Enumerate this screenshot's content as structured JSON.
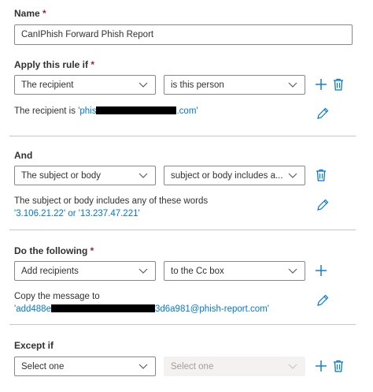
{
  "name": {
    "label": "Name",
    "required_mark": "*",
    "value": "CanIPhish Forward Phish Report"
  },
  "apply_rule": {
    "label": "Apply this rule if",
    "required_mark": "*",
    "condition": "The recipient",
    "operator": "is this person",
    "summary_prefix": "The recipient is ",
    "summary_value_start": "'phis",
    "summary_value_end": ".com'"
  },
  "and": {
    "label": "And",
    "condition": "The subject or body",
    "operator": "subject or body includes a...",
    "summary_line1": "The subject or body includes any of these words",
    "summary_line2": "'3.106.21.22' or '13.237.47.221'"
  },
  "do_following": {
    "label": "Do the following",
    "required_mark": "*",
    "action": "Add recipients",
    "target": "to the Cc box",
    "summary_line1": "Copy the message to",
    "summary_value_start": "'add488e",
    "summary_value_end": "3d6a981@phish-report.com'"
  },
  "except_if": {
    "label": "Except if",
    "condition_placeholder": "Select one",
    "operator_placeholder": "Select one"
  },
  "icons": {
    "chevron": "chevron-down-icon",
    "add": "plus-icon",
    "delete": "trash-icon",
    "edit": "pencil-icon"
  },
  "colors": {
    "accent": "#0078d4",
    "required": "#a4262c",
    "border": "#8a8886",
    "divider": "#c8c6c4",
    "disabled_bg": "#f3f2f1"
  }
}
